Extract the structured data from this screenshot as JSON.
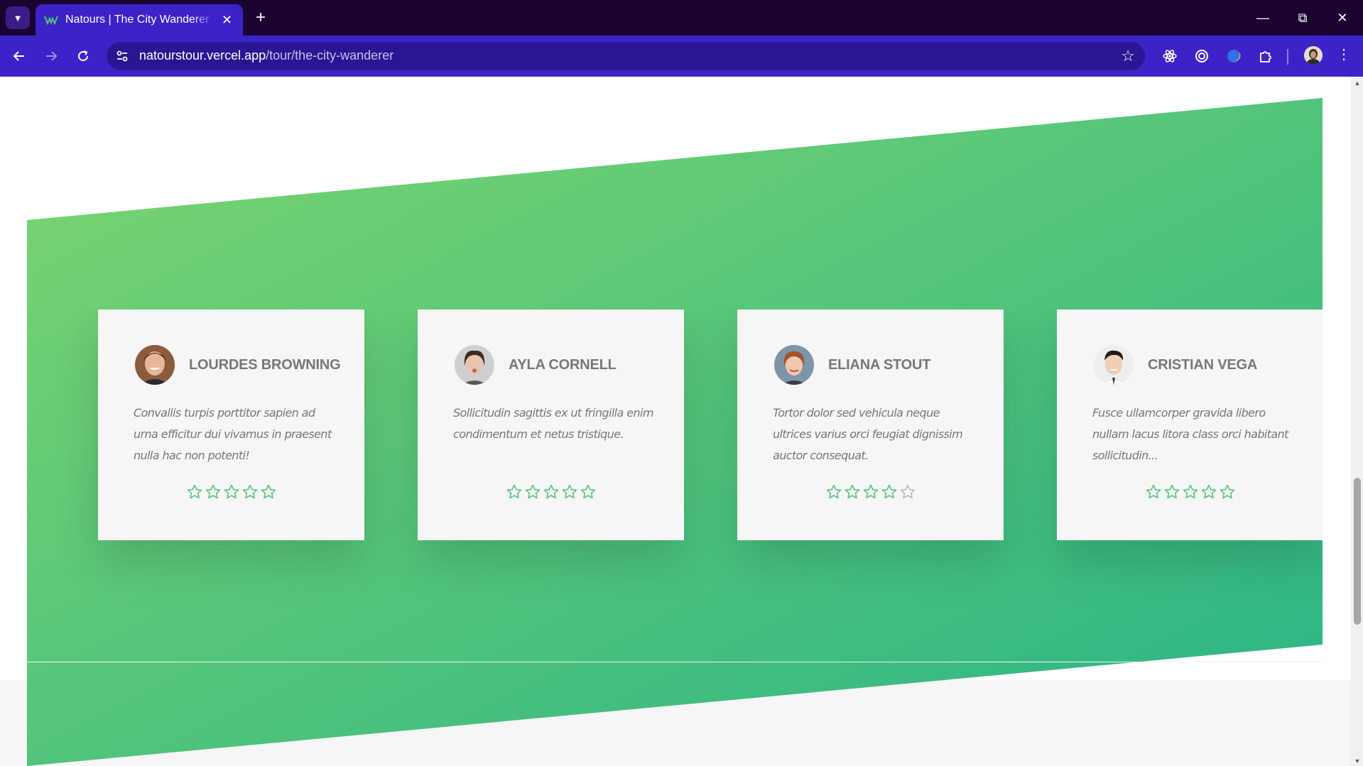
{
  "browser": {
    "tab_title": "Natours | The City Wanderer Tour",
    "url_host": "natourstour.vercel.app",
    "url_path": "/tour/the-city-wanderer"
  },
  "reviews": [
    {
      "name": "LOURDES BROWNING",
      "text": "Convallis turpis porttitor sapien ad urna efficitur dui vivamus in praesent nulla hac non potenti!",
      "rating": 5
    },
    {
      "name": "AYLA CORNELL",
      "text": "Sollicitudin sagittis ex ut fringilla enim condimentum et netus tristique.",
      "rating": 5
    },
    {
      "name": "ELIANA STOUT",
      "text": "Tortor dolor sed vehicula neque ultrices varius orci feugiat dignissim auctor consequat.",
      "rating": 4
    },
    {
      "name": "CRISTIAN VEGA",
      "text": "Fusce ullamcorper gravida libero nullam lacus litora class orci habitant sollicitudin...",
      "rating": 5
    }
  ],
  "colors": {
    "gradient_light": "#7dd56f",
    "gradient_dark": "#28b487",
    "star_active": "#55c57a",
    "star_inactive": "#bbbbbb"
  }
}
